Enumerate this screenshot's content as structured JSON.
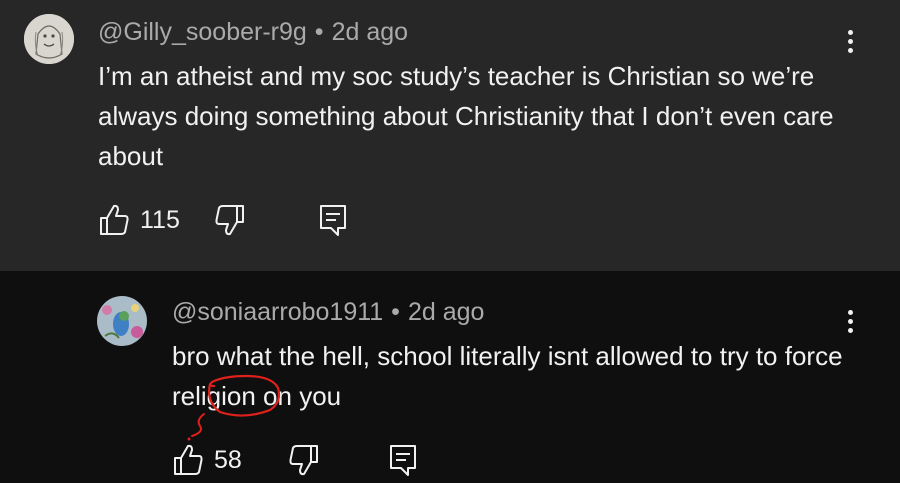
{
  "comments": [
    {
      "author": "@Gilly_soober-r9g",
      "separator": "•",
      "time": "2d ago",
      "text": "I’m an atheist and my soc study’s teacher is Christian so we’re always doing something about Christianity that I don’t even care about",
      "likes": "115",
      "icons": {
        "like": "thumbs-up-icon",
        "dislike": "thumbs-down-icon",
        "reply": "reply-comment-icon",
        "more": "more-vertical-icon"
      }
    },
    {
      "author": "@soniaarrobo1911",
      "separator": "•",
      "time": "2d ago",
      "text_before": "bro what the hell, school literally isnt allowed to try to ",
      "highlight": "force",
      "text_after": " religion on you",
      "likes": "58",
      "icons": {
        "like": "thumbs-up-icon",
        "dislike": "thumbs-down-icon",
        "reply": "reply-comment-icon",
        "more": "more-vertical-icon"
      }
    }
  ],
  "colors": {
    "comment_bg": "#272727",
    "page_bg": "#0f0f0f",
    "meta_text": "#aaaaaa",
    "body_text": "#f1f1f1",
    "annotation_red": "#e0201b"
  }
}
